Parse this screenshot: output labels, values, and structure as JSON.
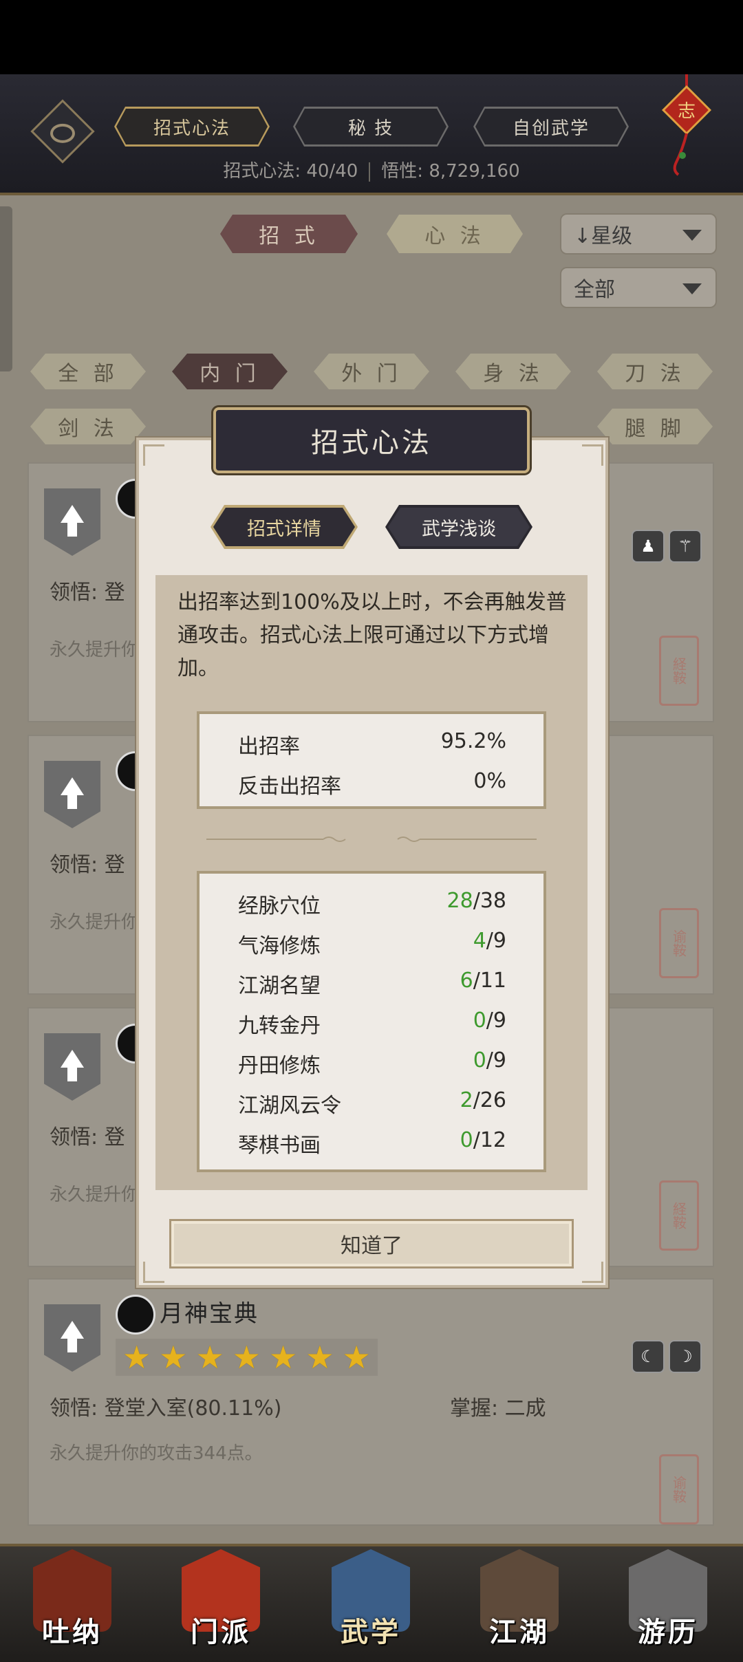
{
  "header": {
    "tabs": [
      {
        "label": "招式心法",
        "active": true
      },
      {
        "label": "秘 技",
        "active": false
      },
      {
        "label": "自创武学",
        "active": false
      }
    ],
    "stats": {
      "left": "招式心法: 40/40",
      "right": "悟性: 8,729,160"
    },
    "knot_char": "志"
  },
  "panel": {
    "segments": [
      {
        "label": "招 式",
        "active": true
      },
      {
        "label": "心 法",
        "active": false
      }
    ],
    "sort_dropdown": "↓星级",
    "filter_dropdown": "全部",
    "filters_row1": [
      {
        "label": "全 部",
        "active": false
      },
      {
        "label": "内 门",
        "active": true
      },
      {
        "label": "外 门",
        "active": false
      },
      {
        "label": "身 法",
        "active": false
      },
      {
        "label": "刀 法",
        "active": false
      }
    ],
    "filters_row2": [
      {
        "label": "剑 法",
        "active": false
      },
      {
        "label": "腿 脚",
        "active": false
      }
    ]
  },
  "cards": [
    {
      "ling": "领悟: 登",
      "desc": "永久提升你",
      "seal": "経鞍"
    },
    {
      "ling": "领悟: 登",
      "desc": "永久提升你",
      "seal": "谕鞍"
    },
    {
      "ling": "领悟: 登",
      "desc": "永久提升你",
      "seal": "経鞍"
    },
    {
      "name": "月神宝典",
      "ling": "领悟: 登堂入室(80.11%)",
      "zhang": "掌握: 二成",
      "desc": "永久提升你的攻击344点。",
      "seal": "谕鞍",
      "stars": 7
    }
  ],
  "dialog": {
    "title": "招式心法",
    "tabs": [
      {
        "label": "招式详情",
        "active": true
      },
      {
        "label": "武学浅谈",
        "active": false
      }
    ],
    "description": "出招率达到100%及以上时，不会再触发普通攻击。招式心法上限可通过以下方式增加。",
    "rates": [
      {
        "label": "出招率",
        "value": "95.2%"
      },
      {
        "label": "反击出招率",
        "value": "0%"
      }
    ],
    "sources": [
      {
        "label": "经脉穴位",
        "current": "28",
        "max": "/38"
      },
      {
        "label": "气海修炼",
        "current": "4",
        "max": "/9"
      },
      {
        "label": "江湖名望",
        "current": "6",
        "max": "/11"
      },
      {
        "label": "九转金丹",
        "current": "0",
        "max": "/9"
      },
      {
        "label": "丹田修炼",
        "current": "0",
        "max": "/9"
      },
      {
        "label": "江湖风云令",
        "current": "2",
        "max": "/26"
      },
      {
        "label": "琴棋书画",
        "current": "0",
        "max": "/12"
      }
    ],
    "ok_label": "知道了"
  },
  "nav": [
    {
      "label": "吐纳",
      "color": "#7a2a1a"
    },
    {
      "label": "门派",
      "color": "#b3331e"
    },
    {
      "label": "武学",
      "color": "#3b5e88"
    },
    {
      "label": "江湖",
      "color": "#5e4a3a"
    },
    {
      "label": "游历",
      "color": "#6b6a6a"
    }
  ],
  "colors": {
    "accent_gold": "#c6ae7e",
    "green": "#3e9a2e"
  }
}
